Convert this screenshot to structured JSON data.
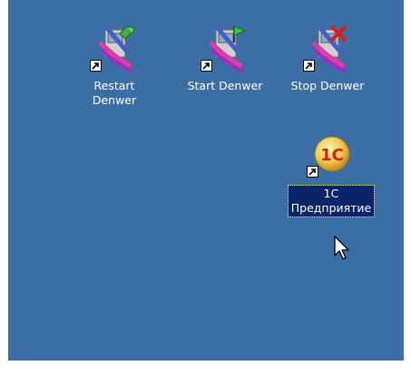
{
  "desktop": {
    "background_color": "#3b6ea5",
    "selection_color": "#0a246a",
    "label_color": "#ffffff",
    "shortcuts": [
      {
        "label": "Restart\nDenwer",
        "icon": "denwer-restart-icon",
        "selected": false
      },
      {
        "label": "Start Denwer",
        "icon": "denwer-start-icon",
        "selected": false
      },
      {
        "label": "Stop Denwer",
        "icon": "denwer-stop-icon",
        "selected": false
      },
      {
        "label": "1C\nПредприятие",
        "icon": "1c-enterprise-icon",
        "selected": true
      }
    ]
  },
  "cursor": {
    "icon": "mouse-pointer-icon"
  }
}
